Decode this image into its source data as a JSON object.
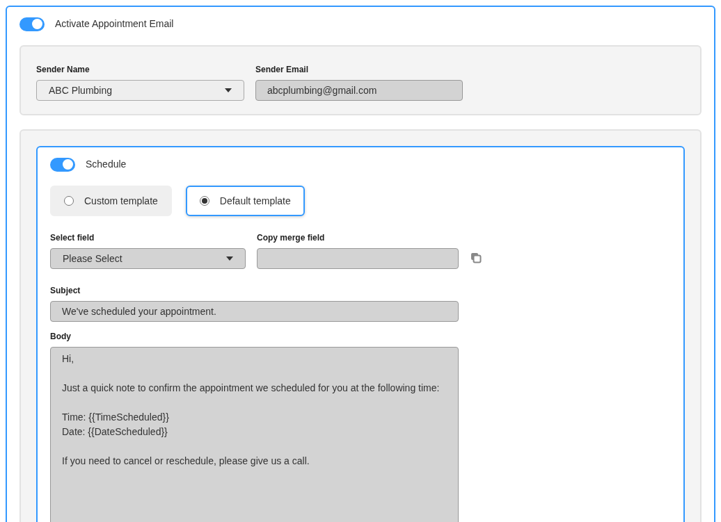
{
  "activate": {
    "label": "Activate Appointment Email",
    "on": true
  },
  "sender": {
    "name_label": "Sender Name",
    "name_value": "ABC Plumbing",
    "email_label": "Sender Email",
    "email_value": "abcplumbing@gmail.com"
  },
  "schedule": {
    "label": "Schedule",
    "on": true,
    "templates": [
      {
        "label": "Custom template",
        "selected": false
      },
      {
        "label": "Default template",
        "selected": true
      }
    ],
    "select_field": {
      "label": "Select field",
      "value": "Please Select"
    },
    "copy_merge_field": {
      "label": "Copy merge field"
    },
    "subject": {
      "label": "Subject",
      "value": "We've scheduled your appointment."
    },
    "body": {
      "label": "Body",
      "paragraphs": [
        [
          "Hi,"
        ],
        [
          "Just a quick note to confirm the appointment we scheduled for you at the following time:"
        ],
        [
          "Time: {{TimeScheduled}}",
          "Date: {{DateScheduled}}"
        ],
        [
          "If you need to cancel or reschedule, please give us a call."
        ]
      ]
    }
  }
}
